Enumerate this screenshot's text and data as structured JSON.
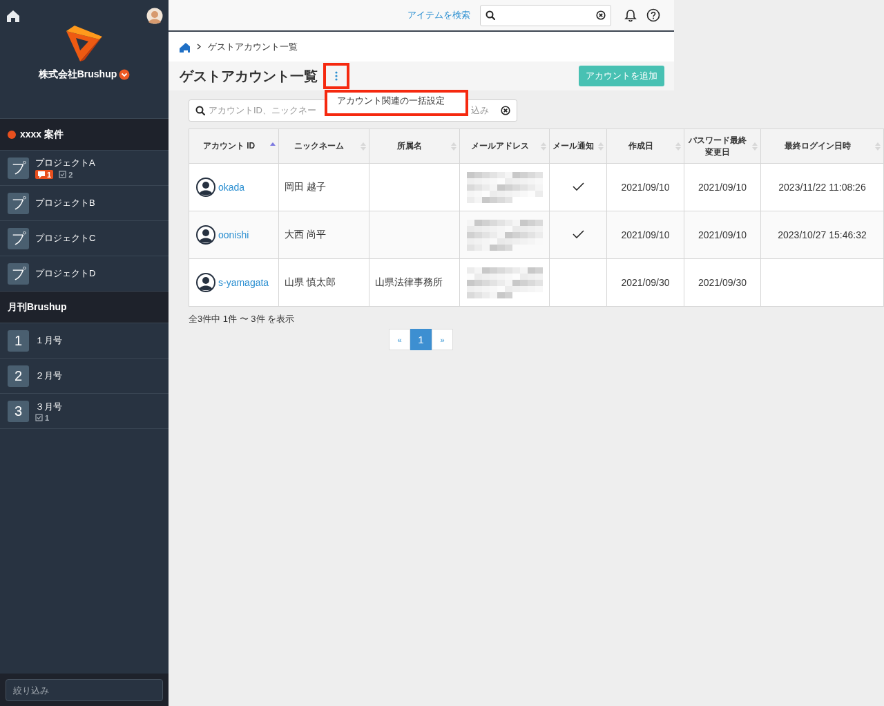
{
  "sidebar": {
    "company": {
      "name": "株式会社Brushup"
    },
    "groups": [
      {
        "title": "xxxx 案件",
        "dot": true,
        "items": [
          {
            "icon_text": "プ",
            "label": "プロジェクトA",
            "comment_count": "1",
            "task_count": "2"
          },
          {
            "icon_text": "プ",
            "label": "プロジェクトB"
          },
          {
            "icon_text": "プ",
            "label": "プロジェクトC"
          },
          {
            "icon_text": "プ",
            "label": "プロジェクトD"
          }
        ]
      },
      {
        "title": "月刊Brushup",
        "dot": false,
        "items": [
          {
            "icon_text": "1",
            "label": "１月号"
          },
          {
            "icon_text": "2",
            "label": "２月号"
          },
          {
            "icon_text": "3",
            "label": "３月号",
            "task_count": "1"
          }
        ]
      }
    ],
    "filter": {
      "placeholder": "絞り込み"
    }
  },
  "header": {
    "search_link": "アイテムを検索"
  },
  "breadcrumb": [
    "ゲストアカウント一覧"
  ],
  "page_title": "ゲストアカウント一覧",
  "menu_button": {
    "highlight": true
  },
  "menu": {
    "open": true,
    "highlight": true,
    "items": [
      "アカウント関連の一括設定"
    ]
  },
  "add_button": "アカウントを追加",
  "filter": {
    "placeholder_start": "アカウントID、ニックネー",
    "placeholder_end": "込み"
  },
  "table": {
    "columns": [
      {
        "label": "アカウント ID",
        "sorted": true
      },
      {
        "label": "ニックネーム",
        "sorted": false
      },
      {
        "label": "所属名",
        "sorted": false
      },
      {
        "label": "メールアドレス",
        "sorted": false
      },
      {
        "label": "メール通知",
        "sorted": false
      },
      {
        "label": "作成日",
        "sorted": false
      },
      {
        "label": "パスワード最終変更日",
        "sorted": false
      },
      {
        "label": "最終ログイン日時",
        "sorted": false
      }
    ],
    "rows": [
      {
        "account_id": "okada",
        "nickname": "岡田 越子",
        "email_redacted": true,
        "mail_notify": true,
        "created": "2021/09/10",
        "password_changed": "2021/09/10",
        "last_login": "2023/11/22 11:08:26"
      },
      {
        "account_id": "oonishi",
        "nickname": "大西 尚平",
        "email_redacted": true,
        "mail_notify": true,
        "created": "2021/09/10",
        "password_changed": "2021/09/10",
        "last_login": "2023/10/27 15:46:32"
      },
      {
        "account_id": "s-yamagata",
        "nickname": "山県 慎太郎",
        "affiliation": "山県法律事務所",
        "email_redacted": true,
        "mail_notify": false,
        "created": "2021/09/30",
        "password_changed": "2021/09/30"
      }
    ]
  },
  "summary": "全3件中 1件 〜 3件 を表示",
  "pagination": {
    "prev": "«",
    "pages": [
      {
        "label": "1",
        "selected": true
      }
    ],
    "next": "»"
  }
}
